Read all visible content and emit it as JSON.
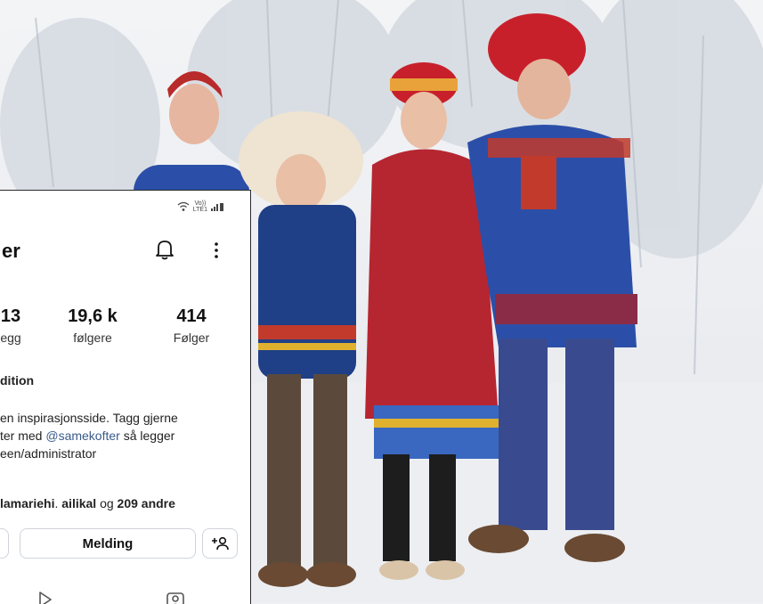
{
  "profile": {
    "name_fragment": "er",
    "stats": [
      {
        "value": "13",
        "label": "egg"
      },
      {
        "value": "19,6 k",
        "label": "følgere"
      },
      {
        "value": "414",
        "label": "Følger"
      }
    ],
    "bio_title": "dition",
    "bio_line1": "en inspirasjonsside. Tagg gjerne",
    "bio_line2_pre": "ter med ",
    "bio_mention": "@samekofter",
    "bio_line2_post": " så legger",
    "bio_line3": "een/administrator",
    "followed_user1": "lamariehi",
    "followed_sep": ". ",
    "followed_user2": "ailikal",
    "followed_mid": " og ",
    "followed_count": "209 andre"
  },
  "status_bar": {
    "network_top": "Vo))",
    "network_bottom": "LTE1"
  },
  "buttons": {
    "message_label": "Melding"
  },
  "icons": {
    "bell": "notification-bell-icon",
    "more": "kebab-menu-icon",
    "add_person": "add-person-icon",
    "reels": "reels-tab-icon",
    "tagged": "tagged-tab-icon"
  },
  "colors": {
    "mention": "#3a5a8a",
    "gakti_blue": "#2b4fa8",
    "hat_red": "#c8202b",
    "snow": "#eef0f3"
  }
}
